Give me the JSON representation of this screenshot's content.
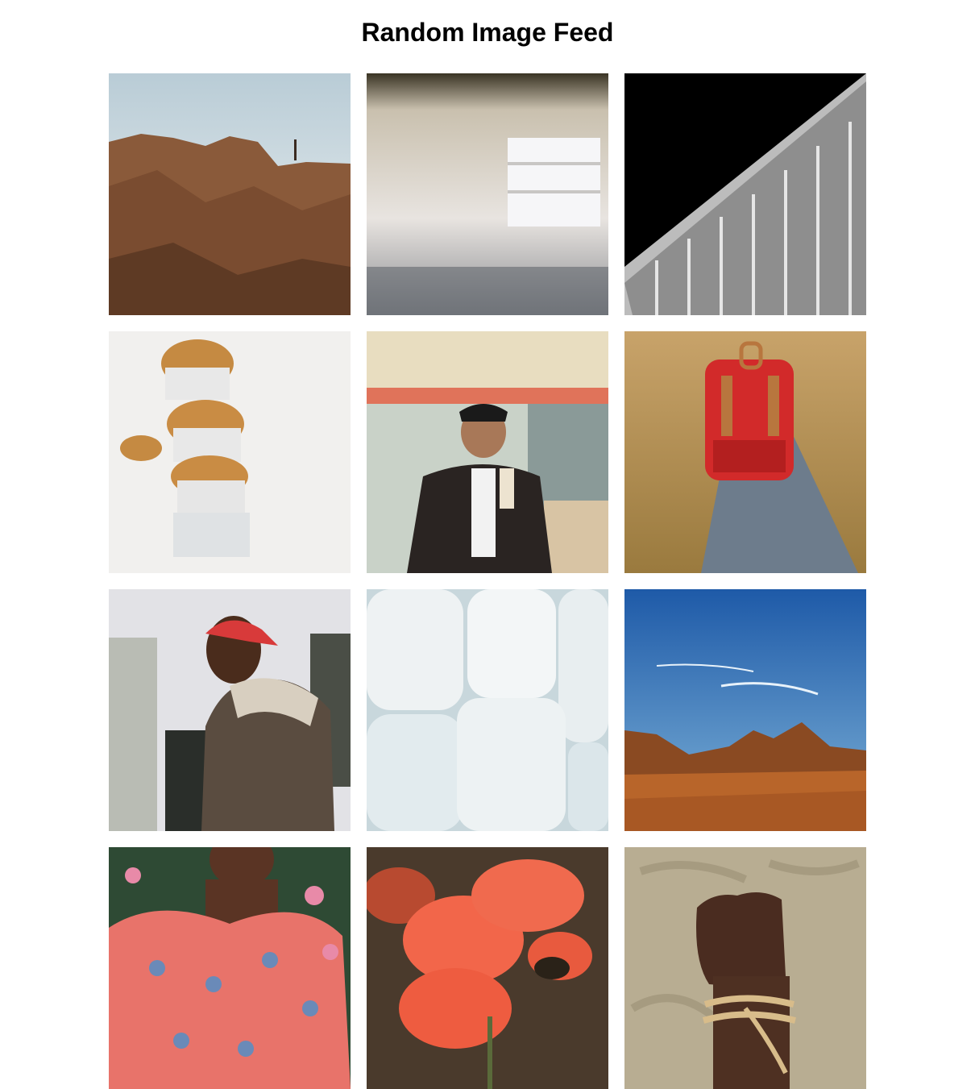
{
  "page": {
    "title": "Random Image Feed"
  },
  "feed": {
    "images": [
      {
        "subject": "rocky-cliff"
      },
      {
        "subject": "hazy-interior"
      },
      {
        "subject": "building-facade"
      },
      {
        "subject": "muffins"
      },
      {
        "subject": "man-in-diner"
      },
      {
        "subject": "red-backpack"
      },
      {
        "subject": "man-red-cap"
      },
      {
        "subject": "white-bales"
      },
      {
        "subject": "desert-mountains"
      },
      {
        "subject": "woman-floral-top"
      },
      {
        "subject": "red-poppies"
      },
      {
        "subject": "bound-fist"
      }
    ]
  }
}
